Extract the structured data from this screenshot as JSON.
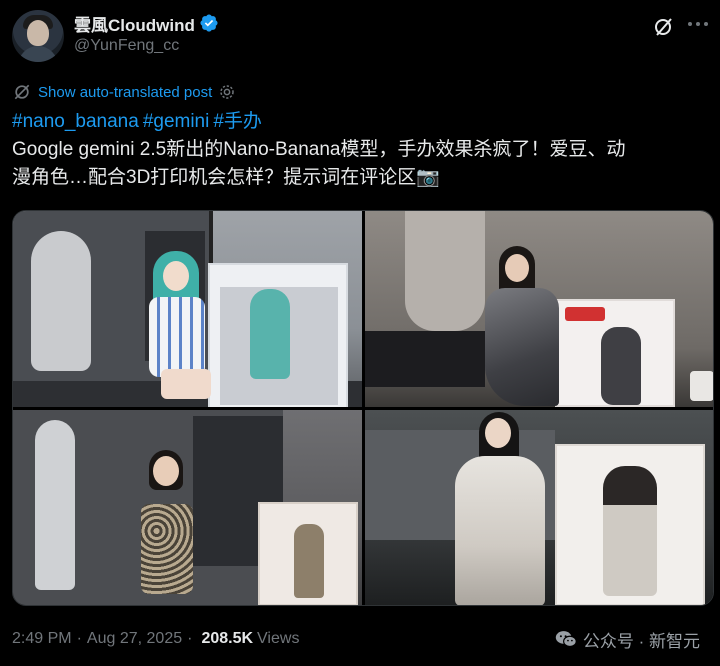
{
  "author": {
    "display_name": "雲風Cloudwind",
    "handle": "@YunFeng_cc"
  },
  "translate": {
    "label": "Show auto-translated post"
  },
  "tweet": {
    "hashtags": [
      "#nano_banana",
      "#gemini",
      "#手办"
    ],
    "line1": "Google gemini 2.5新出的Nano-Banana模型，手办效果杀疯了！爱豆、动",
    "line2": "漫角色…配合3D打印机会怎样？提示词在评论区📷"
  },
  "footer": {
    "time": "2:49 PM",
    "separator": "·",
    "date": "Aug 27, 2025",
    "views_count": "208.5K",
    "views_label": "Views"
  },
  "watermark": {
    "text": "公众号 · 新智元"
  },
  "colors": {
    "accent": "#1d9bf0",
    "background": "#000000",
    "muted": "#71767b"
  }
}
